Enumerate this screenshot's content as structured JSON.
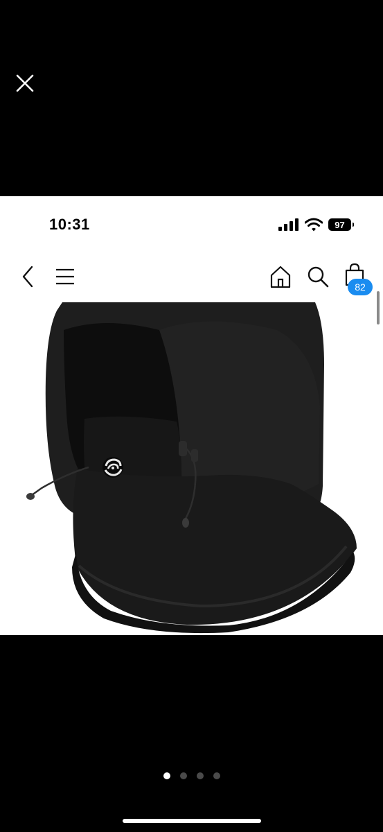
{
  "viewer": {
    "close_icon": "close-icon",
    "pager": {
      "count": 4,
      "active_index": 0
    }
  },
  "status_bar": {
    "time": "10:31",
    "battery": "97",
    "icons": [
      "cellular-signal-icon",
      "wifi-icon",
      "battery-icon"
    ]
  },
  "nav": {
    "icons": [
      "chevron-left-icon",
      "hamburger-menu-icon",
      "home-icon",
      "search-icon",
      "shopping-bag-icon"
    ],
    "cart_count": "82"
  },
  "product": {
    "image": "black-fleece-balaclava-hood"
  },
  "colors": {
    "background": "#000000",
    "badge": "#1a8cf0"
  }
}
